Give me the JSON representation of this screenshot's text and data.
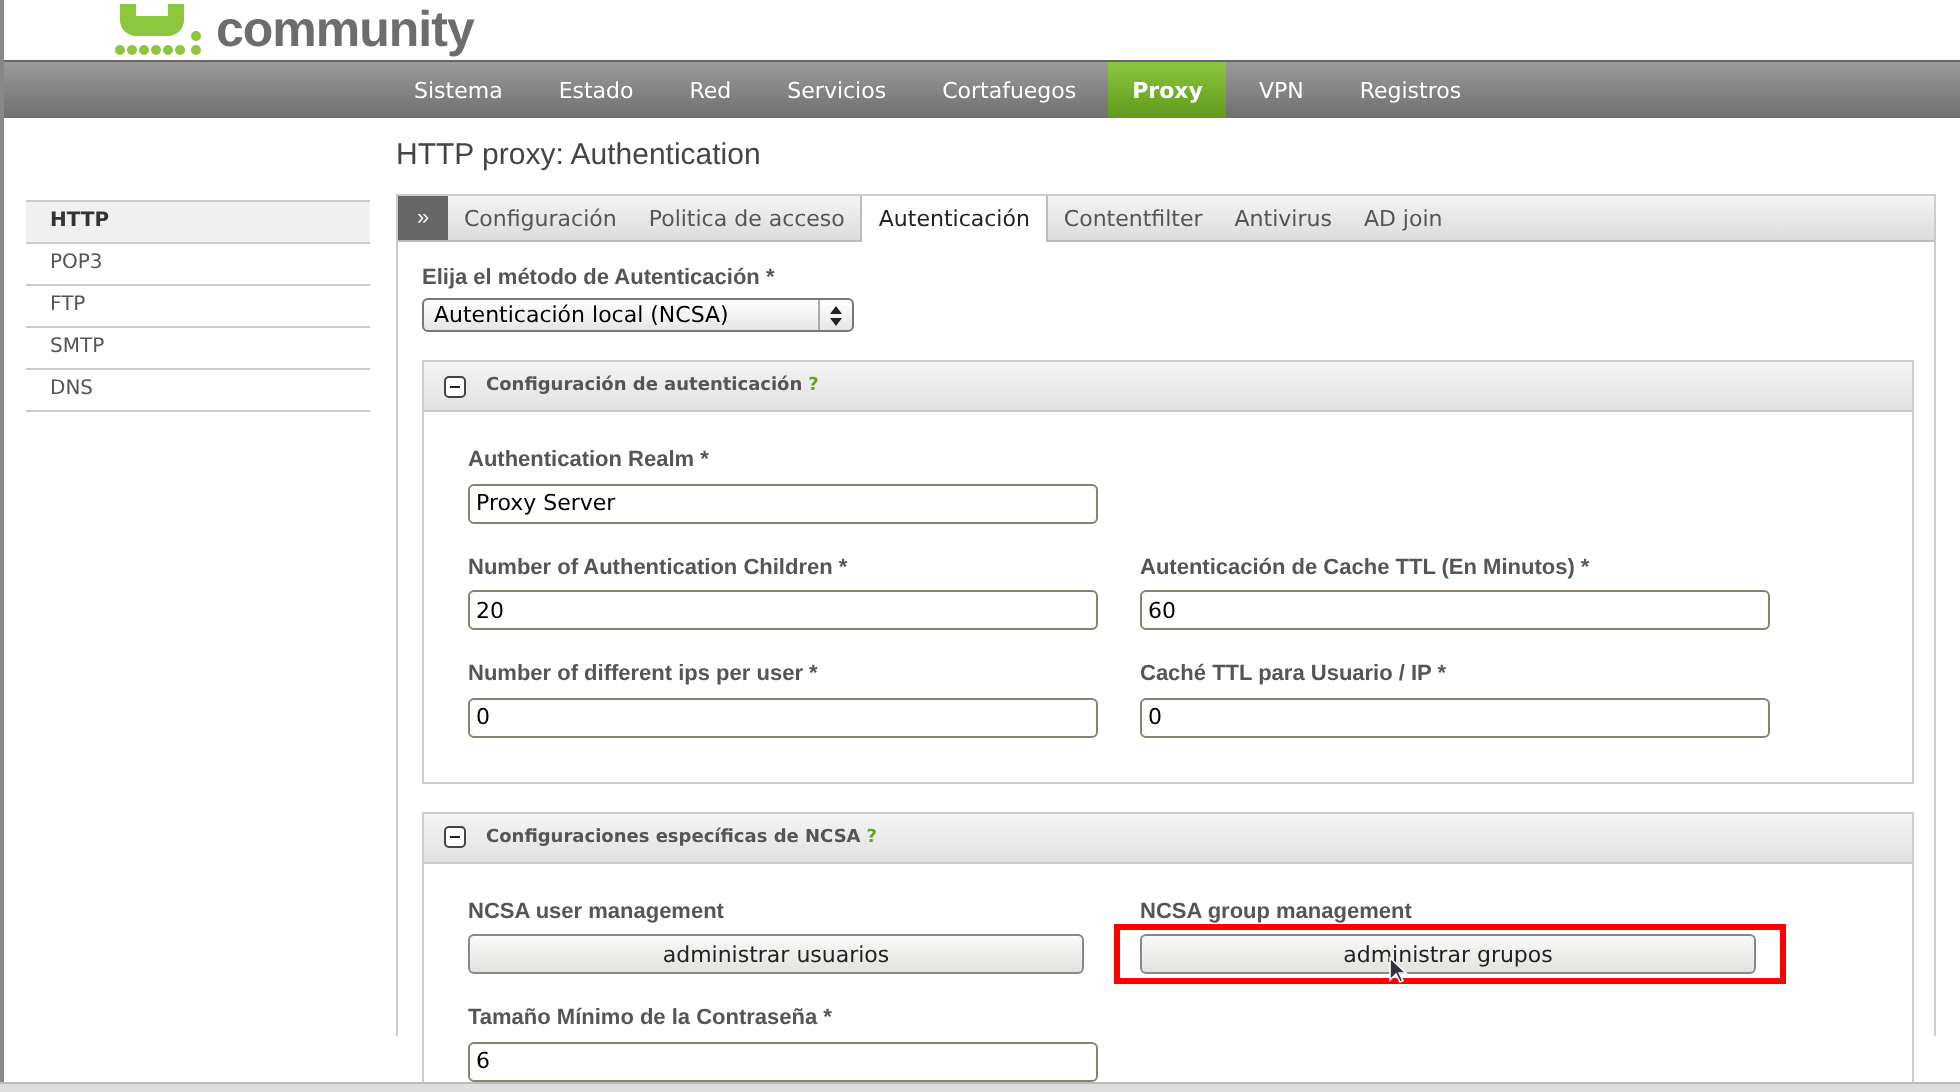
{
  "logo": {
    "text": "community"
  },
  "nav": [
    {
      "label": "Sistema",
      "selected": false
    },
    {
      "label": "Estado",
      "selected": false
    },
    {
      "label": "Red",
      "selected": false
    },
    {
      "label": "Servicios",
      "selected": false
    },
    {
      "label": "Cortafuegos",
      "selected": false
    },
    {
      "label": "Proxy",
      "selected": true
    },
    {
      "label": "VPN",
      "selected": false
    },
    {
      "label": "Registros",
      "selected": false
    }
  ],
  "page_title": "HTTP proxy: Authentication",
  "tabs_toggle": "»",
  "sidebar": {
    "items": [
      {
        "label": "HTTP",
        "selected": true
      },
      {
        "label": "POP3",
        "selected": false
      },
      {
        "label": "FTP",
        "selected": false
      },
      {
        "label": "SMTP",
        "selected": false
      },
      {
        "label": "DNS",
        "selected": false
      }
    ]
  },
  "tabs": [
    {
      "label": "Configuración",
      "selected": false
    },
    {
      "label": "Politica de acceso",
      "selected": false
    },
    {
      "label": "Autenticación",
      "selected": true
    },
    {
      "label": "Contentfilter",
      "selected": false
    },
    {
      "label": "Antivirus",
      "selected": false
    },
    {
      "label": "AD join",
      "selected": false
    }
  ],
  "method": {
    "label": "Elija el método de Autenticación *",
    "value": "Autenticación local (NCSA)"
  },
  "sections": [
    {
      "title": "Configuración de autenticación",
      "help": "?",
      "expanded": true,
      "rows": [
        [
          {
            "kind": "input",
            "label": "Authentication Realm *",
            "value": "Proxy Server"
          }
        ],
        [
          {
            "kind": "input",
            "label": "Number of Authentication Children *",
            "value": "20"
          },
          {
            "kind": "input",
            "label": "Autenticación de Cache TTL (En Minutos) *",
            "value": "60"
          }
        ],
        [
          {
            "kind": "input",
            "label": "Number of different ips per user *",
            "value": "0"
          },
          {
            "kind": "input",
            "label": "Caché TTL para Usuario / IP *",
            "value": "0"
          }
        ]
      ]
    },
    {
      "title": "Configuraciones específicas de NCSA",
      "help": "?",
      "expanded": true,
      "rows": [
        [
          {
            "kind": "button",
            "label": "NCSA user management",
            "value": "administrar usuarios",
            "highlighted": false
          },
          {
            "kind": "button",
            "label": "NCSA group management",
            "value": "administrar grupos",
            "highlighted": true
          }
        ],
        [
          {
            "kind": "input",
            "label": "Tamaño Mínimo de la Contraseña *",
            "value": "6"
          }
        ]
      ]
    }
  ]
}
